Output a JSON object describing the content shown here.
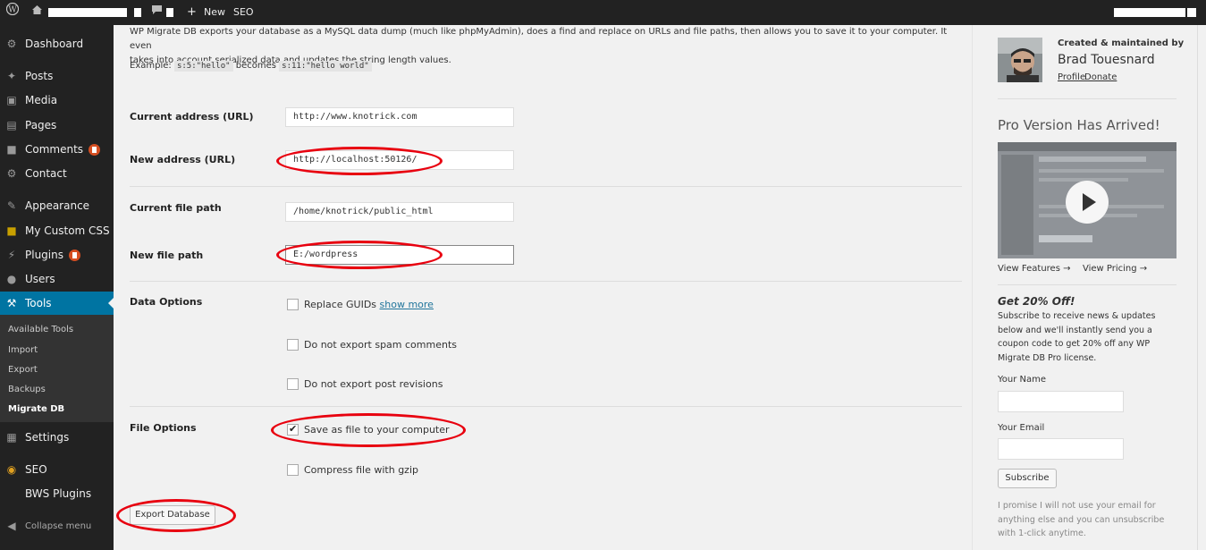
{
  "adminbar": {
    "new_label": "New",
    "seo_label": "SEO"
  },
  "sidebar": {
    "items": [
      {
        "label": "Dashboard",
        "icon": "dashboard-icon"
      },
      {
        "label": "Posts",
        "icon": "pin-icon"
      },
      {
        "label": "Media",
        "icon": "media-icon"
      },
      {
        "label": "Pages",
        "icon": "pages-icon"
      },
      {
        "label": "Comments",
        "icon": "comments-icon"
      },
      {
        "label": "Contact",
        "icon": "gear-icon"
      },
      {
        "label": "Appearance",
        "icon": "brush-icon"
      },
      {
        "label": "My Custom CSS",
        "icon": "css-icon"
      },
      {
        "label": "Plugins",
        "icon": "plug-icon"
      },
      {
        "label": "Users",
        "icon": "users-icon"
      },
      {
        "label": "Tools",
        "icon": "wrench-icon"
      },
      {
        "label": "Settings",
        "icon": "settings-icon"
      },
      {
        "label": "SEO",
        "icon": "seo-icon"
      },
      {
        "label": "BWS Plugins",
        "icon": ""
      }
    ],
    "submenu": [
      "Available Tools",
      "Import",
      "Export",
      "Backups",
      "Migrate DB"
    ],
    "collapse_label": "Collapse menu"
  },
  "main": {
    "intro_line1": "WP Migrate DB exports your database as a MySQL data dump (much like phpMyAdmin), does a find and replace on URLs and file paths, then allows you to save it to your computer. It even",
    "intro_line2": "takes into account serialized data and updates the string length values.",
    "example_label": "Example:",
    "example_before": "s:5:\"hello\"",
    "example_becomes": "becomes",
    "example_after": "s:11:\"hello world\"",
    "current_address_label": "Current address (URL)",
    "current_address_value": "http://www.knotrick.com",
    "new_address_label": "New address (URL)",
    "new_address_value": "http://localhost:50126/",
    "current_path_label": "Current file path",
    "current_path_value": "/home/knotrick/public_html",
    "new_path_label": "New file path",
    "new_path_value": "E:/wordpress",
    "data_options_label": "Data Options",
    "replace_guids_label": "Replace GUIDs",
    "show_more_label": "show more",
    "no_spam_label": "Do not export spam comments",
    "no_revisions_label": "Do not export post revisions",
    "file_options_label": "File Options",
    "save_file_label": "Save as file to your computer",
    "gzip_label": "Compress file with gzip",
    "export_button": "Export Database",
    "annotation_color": "#e8000f"
  },
  "right": {
    "created_label": "Created & maintained by",
    "author_name": "Brad Touesnard",
    "profile_link": "Profile",
    "donate_link": "Donate",
    "pro_heading": "Pro Version Has Arrived!",
    "view_features": "View Features →",
    "view_pricing": "View Pricing →",
    "offer_heading": "Get 20% Off!",
    "offer_text": [
      "Subscribe to receive news & updates",
      "below and we'll instantly send you a",
      "coupon code to get 20% off any WP",
      "Migrate DB Pro license."
    ],
    "name_label": "Your Name",
    "email_label": "Your Email",
    "subscribe_button": "Subscribe",
    "promise_text": [
      "I promise I will not use your email for",
      "anything else and you can unsubscribe",
      "with 1-click anytime."
    ]
  }
}
